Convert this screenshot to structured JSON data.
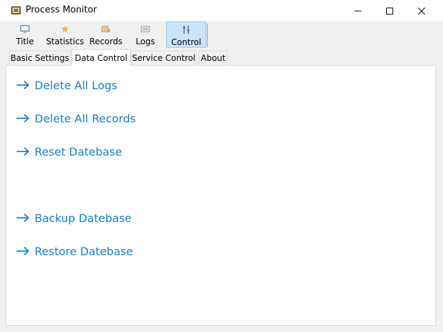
{
  "window": {
    "title": "Process Monitor",
    "icon": "app-icon"
  },
  "toolbar": {
    "buttons": [
      {
        "label": "Title",
        "icon": "monitor-icon"
      },
      {
        "label": "Statistics",
        "icon": "star-icon"
      },
      {
        "label": "Records",
        "icon": "records-icon"
      },
      {
        "label": "Logs",
        "icon": "logs-icon"
      },
      {
        "label": "Control",
        "icon": "control-icon",
        "active": true
      }
    ]
  },
  "tabs": [
    {
      "label": "Basic Settings"
    },
    {
      "label": "Data Control",
      "selected": true
    },
    {
      "label": "Service Control"
    },
    {
      "label": "About"
    }
  ],
  "actions": [
    {
      "label": "Delete All Logs"
    },
    {
      "label": "Delete All Records"
    },
    {
      "label": "Reset Datebase"
    },
    {
      "label": "Backup Datebase"
    },
    {
      "label": "Restore Datebase"
    }
  ],
  "colors": {
    "link": "#1a7fc1",
    "active_toolbar": "#cce4f7",
    "window_bg": "#f0f0f0"
  }
}
